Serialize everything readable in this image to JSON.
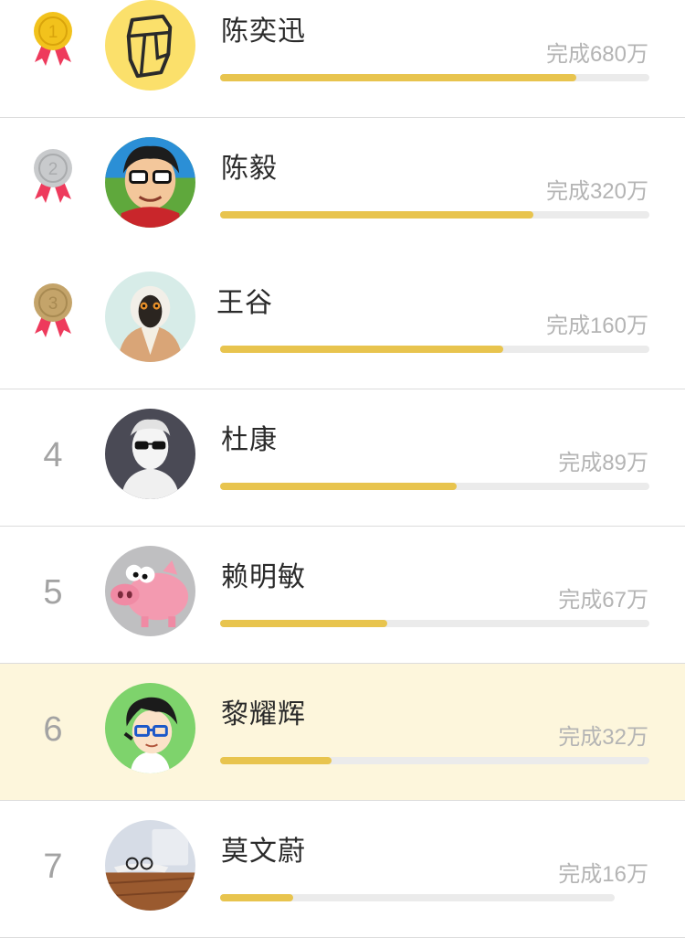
{
  "colors": {
    "progress_fill": "#e8c44e",
    "progress_track": "#ebebeb",
    "highlight_row": "#fdf6dc",
    "gold": "#f2c21c",
    "silver": "#c8cacc",
    "bronze": "#c4a46a",
    "ribbon": "#ee3a5c"
  },
  "ranking": [
    {
      "rank": "1",
      "medal": "gold",
      "name": "陈奕迅",
      "done": "完成680万",
      "progress": 0.83,
      "avatar": "helmet-icon",
      "highlight": false
    },
    {
      "rank": "2",
      "medal": "silver",
      "name": "陈毅",
      "done": "完成320万",
      "progress": 0.73,
      "avatar": "cartoon-man-glasses",
      "highlight": false
    },
    {
      "rank": "3",
      "medal": "bronze",
      "name": "王谷",
      "done": "完成160万",
      "progress": 0.66,
      "avatar": "lemur-in-coat",
      "highlight": false
    },
    {
      "rank": "4",
      "medal": null,
      "name": "杜康",
      "done": "完成89万",
      "progress": 0.55,
      "avatar": "statue-sunglasses",
      "highlight": false
    },
    {
      "rank": "5",
      "medal": null,
      "name": "赖明敏",
      "done": "完成67万",
      "progress": 0.39,
      "avatar": "pink-pig",
      "highlight": false
    },
    {
      "rank": "6",
      "medal": null,
      "name": "黎耀辉",
      "done": "完成32万",
      "progress": 0.26,
      "avatar": "cartoon-boy-glasses",
      "highlight": true
    },
    {
      "rank": "7",
      "medal": null,
      "name": "莫文蔚",
      "done": "完成16万",
      "progress": 0.17,
      "avatar": "desk-glasses-photo",
      "highlight": false
    }
  ]
}
